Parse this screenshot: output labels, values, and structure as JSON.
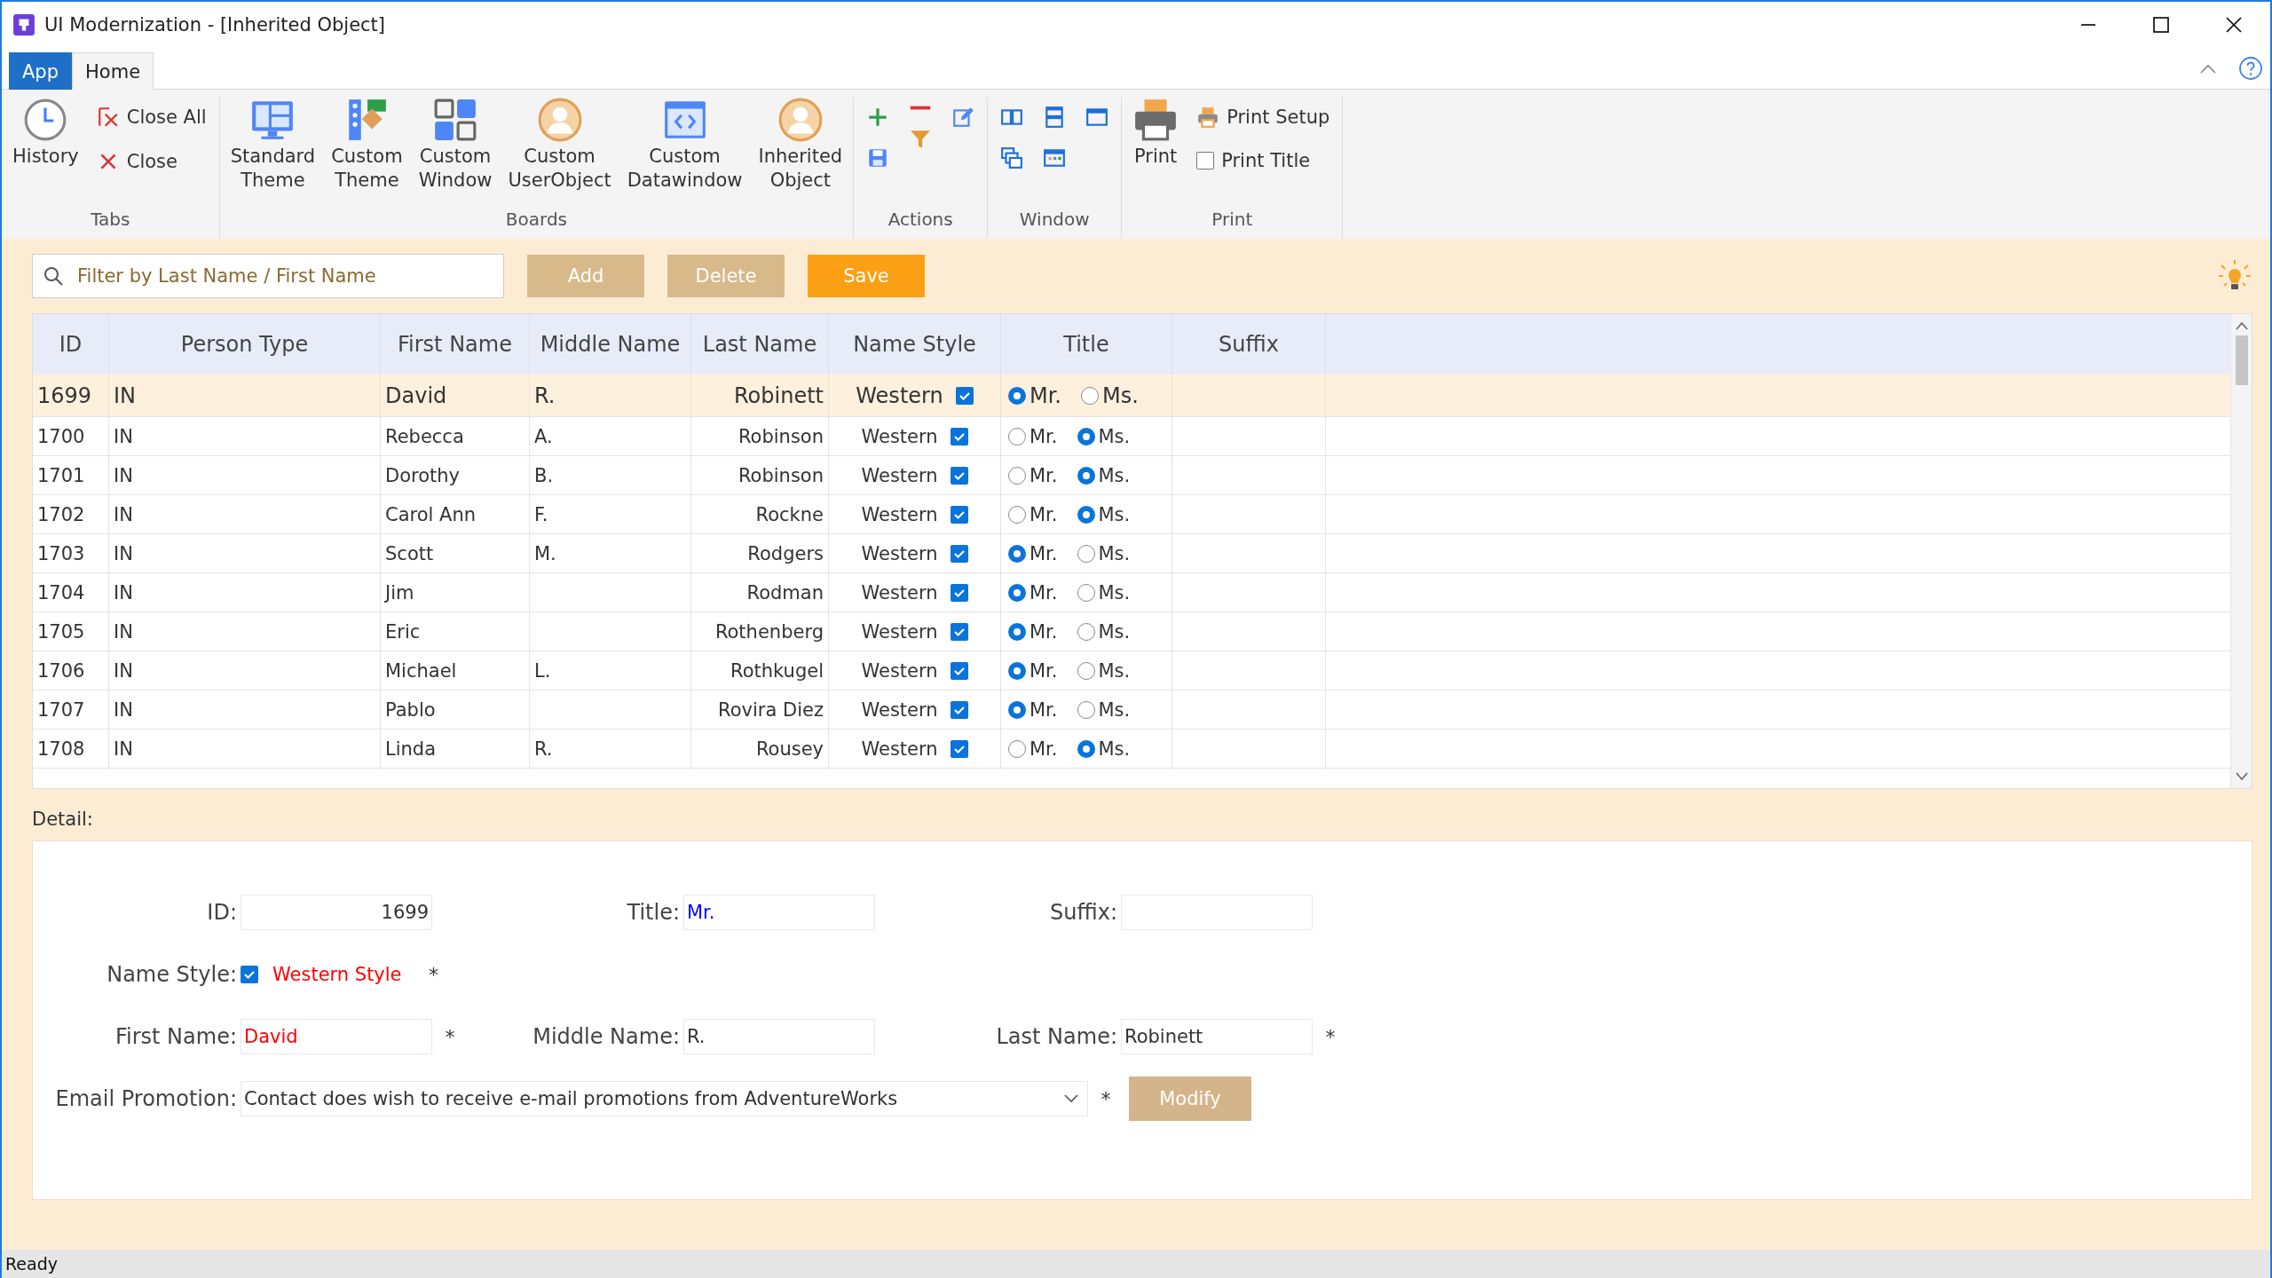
{
  "window": {
    "title": "UI Modernization - [Inherited Object]"
  },
  "ribbon_tabs": [
    {
      "label": "App",
      "kind": "app",
      "selected": false
    },
    {
      "label": "Home",
      "kind": "tab",
      "selected": true
    }
  ],
  "ribbon": {
    "groups": [
      {
        "label": "Tabs",
        "columns": [
          [
            {
              "kind": "large",
              "label": "History"
            }
          ],
          [
            {
              "kind": "small",
              "label": "Close All"
            },
            {
              "kind": "small",
              "label": "Close"
            }
          ]
        ]
      },
      {
        "label": "Boards",
        "columns": [
          [
            {
              "kind": "large",
              "label": "Standard Theme"
            }
          ],
          [
            {
              "kind": "large",
              "label": "Custom Theme"
            }
          ],
          [
            {
              "kind": "large",
              "label": "Custom Window"
            }
          ],
          [
            {
              "kind": "large",
              "label": "Custom UserObject"
            }
          ],
          [
            {
              "kind": "large",
              "label": "Custom Datawindow"
            }
          ],
          [
            {
              "kind": "large",
              "label": "Inherited Object"
            }
          ]
        ]
      },
      {
        "label": "Actions",
        "columns": [
          [
            {
              "kind": "icon"
            },
            {
              "kind": "icon"
            }
          ],
          [
            {
              "kind": "icon"
            },
            {
              "kind": "icon"
            }
          ],
          [
            {
              "kind": "icon"
            }
          ]
        ]
      },
      {
        "label": "Window",
        "columns": [
          [
            {
              "kind": "icon"
            },
            {
              "kind": "icon"
            }
          ],
          [
            {
              "kind": "icon"
            },
            {
              "kind": "icon"
            }
          ],
          [
            {
              "kind": "icon"
            }
          ]
        ]
      },
      {
        "label": "Print",
        "columns": [
          [
            {
              "kind": "large",
              "label": "Print"
            }
          ],
          [
            {
              "kind": "small",
              "label": "Print Setup"
            },
            {
              "kind": "check",
              "label": "Print Title",
              "checked": false
            }
          ]
        ]
      }
    ]
  },
  "filter": {
    "placeholder": "Filter by Last Name / First Name"
  },
  "buttons": [
    {
      "label": "Add",
      "kind": "normal"
    },
    {
      "label": "Delete",
      "kind": "normal"
    },
    {
      "label": "Save",
      "kind": "primary"
    }
  ],
  "table": {
    "columns": [
      "ID",
      "Person Type",
      "First Name",
      "Middle Name",
      "Last Name",
      "Name Style",
      "Title",
      "Suffix"
    ],
    "rows": [
      {
        "selected": true,
        "id": "1699",
        "person_type": "IN",
        "first_name": "David",
        "middle_name": "R.",
        "last_name": "Robinett",
        "name_style": "Western",
        "name_style_checked": true,
        "title": [
          {
            "label": "Mr.",
            "selected": true
          },
          {
            "label": "Ms.",
            "selected": false
          }
        ]
      },
      {
        "selected": false,
        "id": "1700",
        "person_type": "IN",
        "first_name": "Rebecca",
        "middle_name": "A.",
        "last_name": "Robinson",
        "name_style": "Western",
        "name_style_checked": true,
        "title": [
          {
            "label": "Mr.",
            "selected": false
          },
          {
            "label": "Ms.",
            "selected": true
          }
        ]
      },
      {
        "selected": false,
        "id": "1701",
        "person_type": "IN",
        "first_name": "Dorothy",
        "middle_name": "B.",
        "last_name": "Robinson",
        "name_style": "Western",
        "name_style_checked": true,
        "title": [
          {
            "label": "Mr.",
            "selected": false
          },
          {
            "label": "Ms.",
            "selected": true
          }
        ]
      },
      {
        "selected": false,
        "id": "1702",
        "person_type": "IN",
        "first_name": "Carol Ann",
        "middle_name": "F.",
        "last_name": "Rockne",
        "name_style": "Western",
        "name_style_checked": true,
        "title": [
          {
            "label": "Mr.",
            "selected": false
          },
          {
            "label": "Ms.",
            "selected": true
          }
        ]
      },
      {
        "selected": false,
        "id": "1703",
        "person_type": "IN",
        "first_name": "Scott",
        "middle_name": "M.",
        "last_name": "Rodgers",
        "name_style": "Western",
        "name_style_checked": true,
        "title": [
          {
            "label": "Mr.",
            "selected": true
          },
          {
            "label": "Ms.",
            "selected": false
          }
        ]
      },
      {
        "selected": false,
        "id": "1704",
        "person_type": "IN",
        "first_name": "Jim",
        "last_name": "Rodman",
        "name_style": "Western",
        "name_style_checked": true,
        "title": [
          {
            "label": "Mr.",
            "selected": true
          },
          {
            "label": "Ms.",
            "selected": false
          }
        ]
      },
      {
        "selected": false,
        "id": "1705",
        "person_type": "IN",
        "first_name": "Eric",
        "last_name": "Rothenberg",
        "name_style": "Western",
        "name_style_checked": true,
        "title": [
          {
            "label": "Mr.",
            "selected": true
          },
          {
            "label": "Ms.",
            "selected": false
          }
        ]
      },
      {
        "selected": false,
        "id": "1706",
        "person_type": "IN",
        "first_name": "Michael",
        "middle_name": "L.",
        "last_name": "Rothkugel",
        "name_style": "Western",
        "name_style_checked": true,
        "title": [
          {
            "label": "Mr.",
            "selected": true
          },
          {
            "label": "Ms.",
            "selected": false
          }
        ]
      },
      {
        "selected": false,
        "id": "1707",
        "person_type": "IN",
        "first_name": "Pablo",
        "last_name": "Rovira Diez",
        "name_style": "Western",
        "name_style_checked": true,
        "title": [
          {
            "label": "Mr.",
            "selected": true
          },
          {
            "label": "Ms.",
            "selected": false
          }
        ]
      },
      {
        "selected": false,
        "id": "1708",
        "person_type": "IN",
        "first_name": "Linda",
        "middle_name": "R.",
        "last_name": "Rousey",
        "name_style": "Western",
        "name_style_checked": true,
        "title": [
          {
            "label": "Mr.",
            "selected": false
          },
          {
            "label": "Ms.",
            "selected": true
          }
        ]
      }
    ]
  },
  "detail": {
    "heading": "Detail:",
    "rows": [
      {
        "fields": [
          {
            "kind": "number",
            "label": "ID:",
            "value": "1699"
          },
          {
            "kind": "text",
            "label": "Title:",
            "value": "Mr.",
            "color": "#0000ff"
          },
          {
            "kind": "text",
            "label": "Suffix:"
          }
        ]
      },
      {
        "fields": [
          {
            "kind": "check",
            "label": "Name Style:",
            "checked": true,
            "value": "Western Style",
            "color": "#ff0000",
            "required": "*"
          }
        ]
      },
      {
        "fields": [
          {
            "kind": "text",
            "label": "First Name:",
            "value": "David",
            "color": "#ff0000",
            "required": "*"
          },
          {
            "kind": "text",
            "label": "Middle Name:",
            "value": "R."
          },
          {
            "kind": "text",
            "label": "Last Name:",
            "value": "Robinett",
            "required": "*"
          }
        ]
      },
      {
        "fields": [
          {
            "kind": "dropdown",
            "label": "Email Promotion:",
            "value": "Contact does wish to receive e-mail promotions from AdventureWorks",
            "required": "*"
          }
        ],
        "button": "Modify"
      }
    ]
  },
  "status_bar": {
    "text": "Ready"
  }
}
